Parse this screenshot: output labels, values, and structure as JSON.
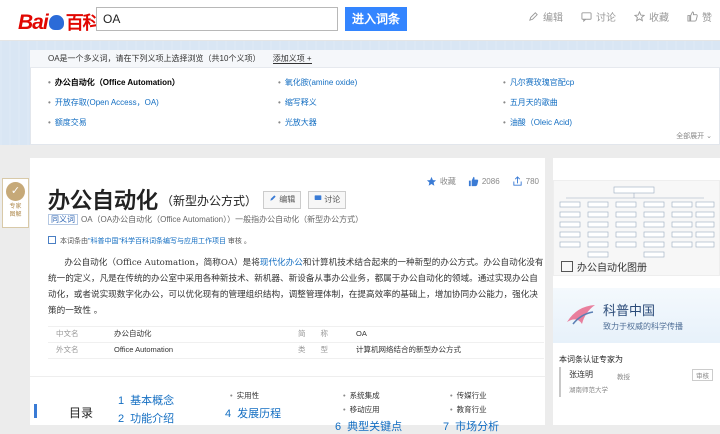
{
  "header": {
    "logo_text": "Bai",
    "logo_du": "du",
    "logo_baike": "百科",
    "search_value": "OA",
    "search_button": "进入词条",
    "actions": [
      {
        "label": "编辑",
        "icon": "pencil-icon"
      },
      {
        "label": "讨论",
        "icon": "chat-icon"
      },
      {
        "label": "收藏",
        "icon": "star-icon"
      },
      {
        "label": "赞",
        "icon": "thumbs-up-icon"
      }
    ]
  },
  "polysemy": {
    "intro": "OA是一个多义词，请在下列义项上选择浏览（共10个义项）",
    "add_tab": "添加义项 +",
    "items": [
      {
        "label": "办公自动化（Office Automation）",
        "active": true
      },
      {
        "label": "氧化胺(amine oxide)",
        "active": false
      },
      {
        "label": "凡尔赛玫瑰官配cp",
        "active": false
      },
      {
        "label": "开放存取(Open Access，OA)",
        "active": false
      },
      {
        "label": "缩写释义",
        "active": false
      },
      {
        "label": "五月天的歌曲",
        "active": false
      },
      {
        "label": "额度交易",
        "active": false
      },
      {
        "label": "光放大器",
        "active": false
      },
      {
        "label": "油酸（Oleic Acid)",
        "active": false
      }
    ],
    "collapse": "全部展开 ⌄"
  },
  "side_badge": {
    "label1": "专家",
    "label2": "图解"
  },
  "article": {
    "title": "办公自动化",
    "subtitle": "（新型办公方式）",
    "edit_btn": "编辑",
    "talk_btn": "讨论",
    "favorites": "收藏",
    "likes": "2086",
    "shares": "780",
    "polyline_tag": "同义词",
    "polyline_text": "OA（OA办公自动化（Office Automation））一般指办公自动化（新型办公方式）",
    "cite_pre": "本词条由",
    "cite_link": "\"科普中国\"科学百科词条编写与应用工作项目",
    "cite_post": " 审核 。",
    "para_a": "办公自动化（Office Automation，简称OA）是将",
    "para_link": "现代化办公",
    "para_b": "和计算机技术结合起来的一种新型的办公方式。办公自动化没有统一的定义，凡是在传统的办公室中采用各种新技术、新机器、新设备从事办公业务，都属于办公自动化的领域。通过实现办公自动化，或者说实现数字化办公，可以优化现有的管理组织结构，调整管理体制，在提高效率的基础上，增加协同办公能力，强化决策的一致性 。",
    "info": [
      {
        "key": "中文名",
        "value": "办公自动化"
      },
      {
        "key": "简　　称",
        "value": "OA"
      },
      {
        "key": "外文名",
        "value": "Office Automation"
      },
      {
        "key": "类　　型",
        "value": "计算机网络结合的新型办公方式"
      }
    ]
  },
  "toc": {
    "title": "目录",
    "items": [
      {
        "num": "1",
        "label": "基本概念"
      },
      {
        "num": "2",
        "label": "功能介绍"
      },
      {
        "num": "4",
        "label": "发展历程"
      },
      {
        "num": "6",
        "label": "典型关键点"
      },
      {
        "num": "7",
        "label": "市场分析"
      }
    ],
    "subs": [
      "实用性",
      "系统集成",
      "移动应用",
      "传媒行业",
      "教育行业"
    ]
  },
  "sidebar": {
    "album_caption": "办公自动化图册",
    "kepu_title": "科普中国",
    "kepu_sub": "致力于权威的科学传播",
    "expert_title": "本词条认证专家为",
    "expert_name": "张连明",
    "expert_role": "教授",
    "expert_org": "湖南师范大学",
    "expert_tag": "审核"
  }
}
